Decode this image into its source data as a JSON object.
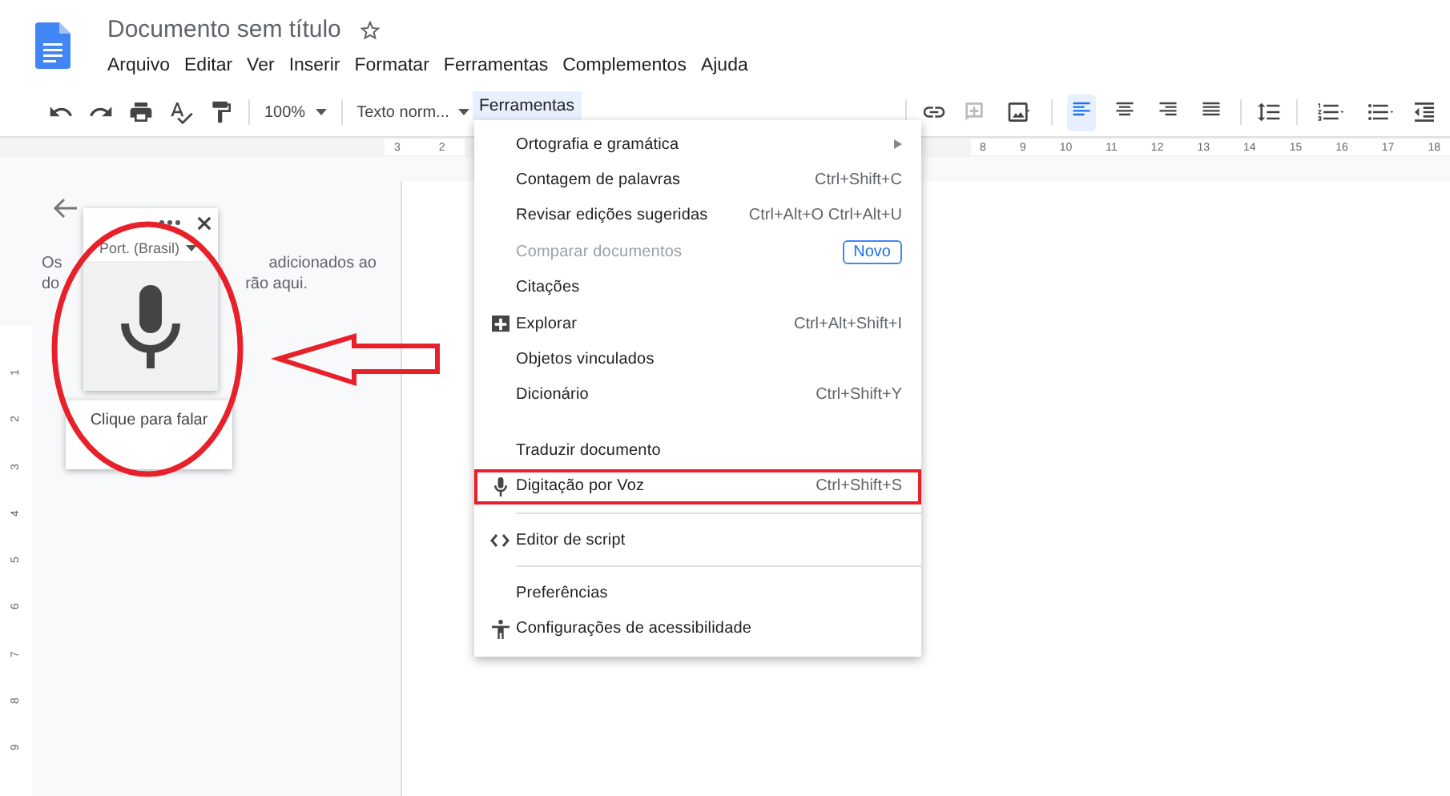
{
  "document": {
    "title": "Documento sem título",
    "starred": false
  },
  "menubar": [
    "Arquivo",
    "Editar",
    "Ver",
    "Inserir",
    "Formatar",
    "Ferramentas",
    "Complementos",
    "Ajuda"
  ],
  "toolbar": {
    "zoom": "100%",
    "style": "Texto norm...",
    "alignment": [
      {
        "selected": true
      },
      {
        "selected": false
      },
      {
        "selected": false
      },
      {
        "selected": false
      }
    ]
  },
  "ruler": {
    "left_numbers": [
      "3",
      "2"
    ],
    "right_numbers": [
      "8",
      "9",
      "10",
      "11",
      "12",
      "13",
      "14",
      "15",
      "16",
      "17",
      "18"
    ],
    "vertical_numbers": [
      "1",
      "2",
      "3",
      "4",
      "5",
      "6",
      "7",
      "8",
      "9"
    ]
  },
  "sidebar": {
    "line_1_start": "Os",
    "line_1_end": "adicionados ao",
    "line_2_start": "do",
    "line_2_end": "rão aqui."
  },
  "voice_popup": {
    "language": "Port. (Brasil)",
    "hint": "Clique para falar"
  },
  "open_menu": {
    "label": "Ferramentas",
    "items": [
      {
        "kind": "item",
        "label": "Ortografia e gramática",
        "submenu": true,
        "disabled": false,
        "highlighted": false
      },
      {
        "kind": "item",
        "label": "Contagem de palavras",
        "shortcut": "Ctrl+Shift+C",
        "submenu": false,
        "disabled": false,
        "highlighted": false
      },
      {
        "kind": "item",
        "label": "Revisar edições sugeridas",
        "shortcut": "Ctrl+Alt+O Ctrl+Alt+U",
        "submenu": false,
        "disabled": false,
        "highlighted": false
      },
      {
        "kind": "item",
        "label": "Comparar documentos",
        "badge": "Novo",
        "submenu": false,
        "disabled": true,
        "highlighted": false
      },
      {
        "kind": "item",
        "label": "Citações",
        "submenu": false,
        "disabled": false,
        "highlighted": false
      },
      {
        "kind": "explore",
        "label": "Explorar",
        "shortcut": "Ctrl+Alt+Shift+I",
        "submenu": false,
        "disabled": false,
        "highlighted": false
      },
      {
        "kind": "item",
        "label": "Objetos vinculados",
        "submenu": false,
        "disabled": false,
        "highlighted": false
      },
      {
        "kind": "item",
        "label": "Dicionário",
        "shortcut": "Ctrl+Shift+Y",
        "submenu": false,
        "disabled": false,
        "highlighted": false
      },
      {
        "kind": "gap"
      },
      {
        "kind": "item",
        "label": "Traduzir documento",
        "submenu": false,
        "disabled": false,
        "highlighted": false
      },
      {
        "kind": "voice",
        "label": "Digitação por Voz",
        "shortcut": "Ctrl+Shift+S",
        "submenu": false,
        "disabled": false,
        "highlighted": true
      },
      {
        "kind": "separator"
      },
      {
        "kind": "script",
        "label": "Editor de script",
        "submenu": false,
        "disabled": false,
        "highlighted": false
      },
      {
        "kind": "separator"
      },
      {
        "kind": "item",
        "label": "Preferências",
        "submenu": false,
        "disabled": false,
        "highlighted": false
      },
      {
        "kind": "access",
        "label": "Configurações de acessibilidade",
        "submenu": false,
        "disabled": false,
        "highlighted": false
      }
    ]
  }
}
